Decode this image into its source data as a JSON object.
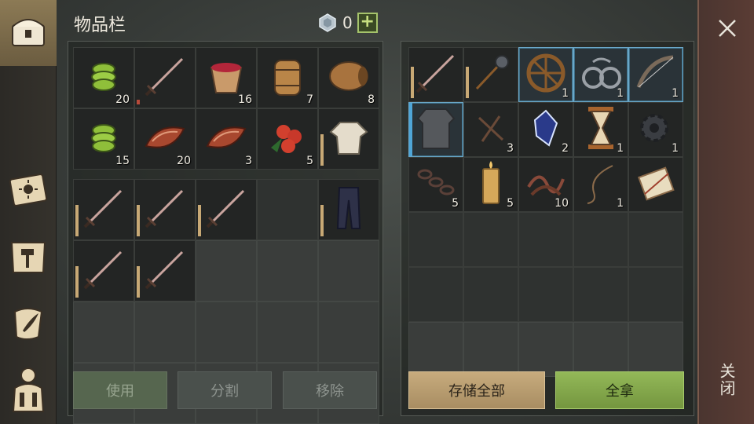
{
  "header": {
    "title": "物品栏",
    "currency_count": "0",
    "plus_label": "+"
  },
  "close": {
    "label": "关闭"
  },
  "buttons": {
    "use": "使用",
    "split": "分割",
    "remove": "移除",
    "store_all": "存储全部",
    "take_all": "全拿"
  },
  "colors": {
    "accent_green": "#93b858",
    "accent_tan": "#c7ab7d",
    "close_strip": "#4a3530"
  },
  "inventory": {
    "row1": [
      {
        "icon": "cactus-icon",
        "qty": "20"
      },
      {
        "icon": "sword-icon",
        "qty": ""
      },
      {
        "icon": "berry-bucket-icon",
        "qty": "16"
      },
      {
        "icon": "barrel-icon",
        "qty": "7"
      },
      {
        "icon": "keg-icon",
        "qty": "8"
      }
    ],
    "row2": [
      {
        "icon": "cactus-icon",
        "qty": "15"
      },
      {
        "icon": "meat-icon",
        "qty": "20"
      },
      {
        "icon": "meat-icon",
        "qty": "3"
      },
      {
        "icon": "berries-icon",
        "qty": "5"
      },
      {
        "icon": "shirt-icon",
        "qty": ""
      }
    ],
    "equip_row1": [
      {
        "icon": "sword-icon",
        "qty": ""
      },
      {
        "icon": "sword-icon",
        "qty": ""
      },
      {
        "icon": "sword-icon",
        "qty": ""
      },
      {
        "icon": "",
        "qty": ""
      },
      {
        "icon": "pants-icon",
        "qty": ""
      }
    ],
    "equip_row2": [
      {
        "icon": "sword-icon",
        "qty": ""
      },
      {
        "icon": "sword-icon",
        "qty": ""
      }
    ]
  },
  "storage": {
    "row1": [
      {
        "icon": "sword-icon",
        "qty": ""
      },
      {
        "icon": "mace-icon",
        "qty": ""
      },
      {
        "icon": "wheel-icon",
        "qty": "1"
      },
      {
        "icon": "shackles-icon",
        "qty": "1"
      },
      {
        "icon": "bow-icon",
        "qty": "1"
      }
    ],
    "row2": [
      {
        "icon": "chainmail-icon",
        "qty": ""
      },
      {
        "icon": "nails-icon",
        "qty": "3"
      },
      {
        "icon": "crystal-icon",
        "qty": "2"
      },
      {
        "icon": "hourglass-icon",
        "qty": "1"
      },
      {
        "icon": "gear-icon",
        "qty": "1"
      }
    ],
    "row3": [
      {
        "icon": "chain-icon",
        "qty": "5"
      },
      {
        "icon": "candle-icon",
        "qty": "5"
      },
      {
        "icon": "rope-pile-icon",
        "qty": "10"
      },
      {
        "icon": "whip-icon",
        "qty": "1"
      },
      {
        "icon": "scroll-icon",
        "qty": ""
      }
    ]
  }
}
